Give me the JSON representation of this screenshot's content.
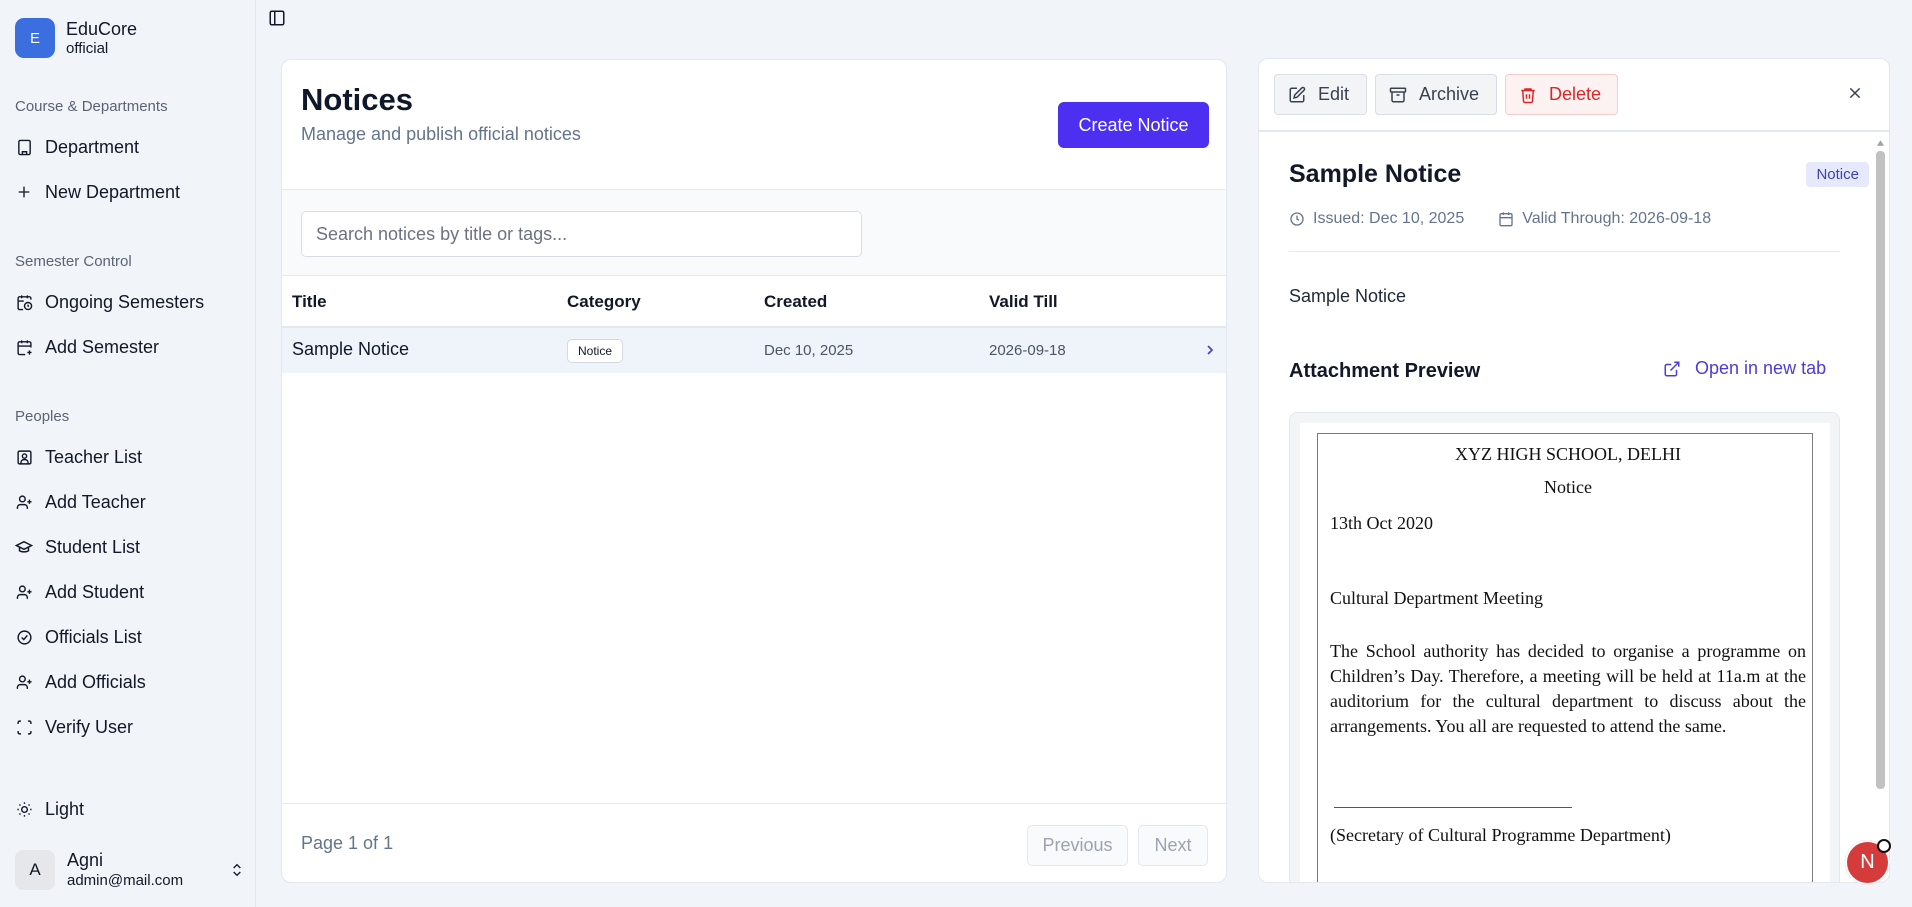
{
  "brand": {
    "logo_letter": "E",
    "name": "EduCore",
    "sub": "official"
  },
  "sidebar": {
    "groups": [
      {
        "label": "Course & Departments"
      },
      {
        "label": "Semester Control"
      },
      {
        "label": "Peoples"
      }
    ],
    "items": [
      {
        "label": "Department",
        "icon": "building-icon"
      },
      {
        "label": "New Department",
        "icon": "plus-icon"
      },
      {
        "label": "Ongoing Semesters",
        "icon": "calendar-clock-icon"
      },
      {
        "label": "Add Semester",
        "icon": "calendar-plus-icon"
      },
      {
        "label": "Teacher List",
        "icon": "contact-card-icon"
      },
      {
        "label": "Add Teacher",
        "icon": "user-plus-icon"
      },
      {
        "label": "Student List",
        "icon": "graduation-cap-icon"
      },
      {
        "label": "Add Student",
        "icon": "user-plus-icon"
      },
      {
        "label": "Officials List",
        "icon": "check-circle-icon"
      },
      {
        "label": "Add Officials",
        "icon": "user-plus-icon"
      },
      {
        "label": "Verify User",
        "icon": "scan-icon"
      }
    ],
    "theme_label": "Light",
    "user": {
      "initial": "A",
      "name": "Agni",
      "email": "admin@mail.com"
    }
  },
  "main": {
    "title": "Notices",
    "subtitle": "Manage and publish official notices",
    "create_label": "Create Notice",
    "search_placeholder": "Search notices by title or tags...",
    "columns": [
      "Title",
      "Category",
      "Created",
      "Valid Till"
    ],
    "rows": [
      {
        "title": "Sample Notice",
        "category": "Notice",
        "created": "Dec 10, 2025",
        "valid_till": "2026-09-18"
      }
    ],
    "page_info": "Page 1 of 1",
    "prev_label": "Previous",
    "next_label": "Next"
  },
  "detail": {
    "edit_label": "Edit",
    "archive_label": "Archive",
    "delete_label": "Delete",
    "title": "Sample Notice",
    "badge": "Notice",
    "issued": "Issued: Dec 10, 2025",
    "valid_through": "Valid Through: 2026-09-18",
    "content": "Sample Notice",
    "attachment_title": "Attachment Preview",
    "open_tab_label": "Open in new tab",
    "doc": {
      "school": "XYZ HIGH SCHOOL, DELHI",
      "heading": "Notice",
      "date": "13th Oct 2020",
      "subject": "Cultural Department Meeting",
      "body": "The School authority has decided to organise a programme on Children’s Day. Therefore, a meeting will be held at 11a.m at the auditorium for the cultural department to discuss about the arrangements. You all are requested to attend the same.",
      "signatory": "(Secretary of Cultural Programme Department)"
    }
  },
  "fab": {
    "letter": "N"
  },
  "colors": {
    "primary": "#4c2ff0",
    "brand": "#3b6fe0",
    "danger": "#dc2626",
    "link": "#4c3cd6"
  }
}
